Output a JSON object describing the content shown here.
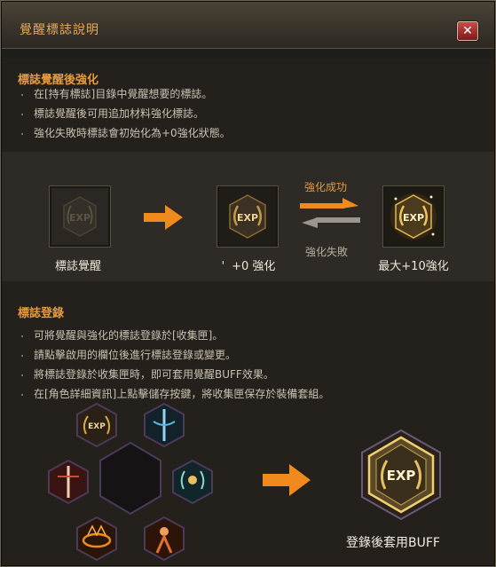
{
  "window": {
    "title": "覺醒標誌說明",
    "close_glyph": "✕"
  },
  "section1": {
    "heading": "標誌覺醒後強化",
    "lines": [
      "在[持有標誌]目錄中覺醒想要的標誌。",
      "標誌覺醒後可用追加材料強化標誌。",
      "強化失敗時標誌會初始化為+0強化狀態。"
    ]
  },
  "flow": {
    "step1_label": "標誌覺醒",
    "step2_label": "+0 強化",
    "step2_prefix": "'",
    "success_label": "強化成功",
    "fail_label": "強化失敗",
    "step3_label": "最大+10強化",
    "exp_text": "EXP"
  },
  "section2": {
    "heading": "標誌登錄",
    "lines": [
      "可將覺醒與強化的標誌登錄於[收集匣]。",
      "請點擊啟用的欄位後進行標誌登錄或變更。",
      "將標誌登錄於收集匣時，即可套用覺醒BUFF效果。",
      "在[角色詳細資訊]上點擊儲存按鍵，將收集匣保存於裝備套組。"
    ],
    "buff_label": "登錄後套用BUFF"
  },
  "colors": {
    "accent": "#e69a3e",
    "arrow": "#f08a1c"
  }
}
